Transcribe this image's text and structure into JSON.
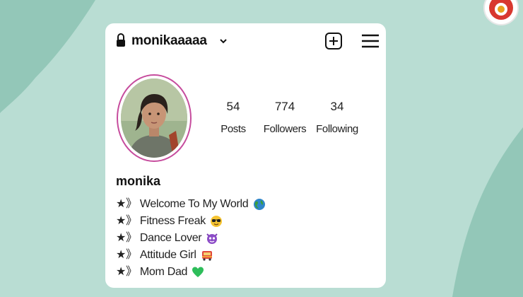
{
  "profile": {
    "username": "monikaaaaa",
    "display_name": "monika",
    "stats": [
      {
        "value": "54",
        "label": "Posts"
      },
      {
        "value": "774",
        "label": "Followers"
      },
      {
        "value": "34",
        "label": "Following"
      }
    ],
    "bio": [
      {
        "prefix": "★》",
        "text": " Welcome To My World ",
        "emoji": "globe-icon"
      },
      {
        "prefix": "★》",
        "text": " Fitness Freak",
        "emoji": "sunglasses-face-icon"
      },
      {
        "prefix": "★》",
        "text": " Dance Lover",
        "emoji": "devil-face-icon"
      },
      {
        "prefix": "★》",
        "text": " Attitude Girl",
        "emoji": "bus-icon"
      },
      {
        "prefix": "★》",
        "text": " Mom Dad ",
        "emoji": "green-heart-icon"
      }
    ]
  },
  "colors": {
    "background": "#b9ddd3",
    "blob_dark": "#93c7b8",
    "avatar_ring": "#c64c9d",
    "card": "#ffffff"
  }
}
